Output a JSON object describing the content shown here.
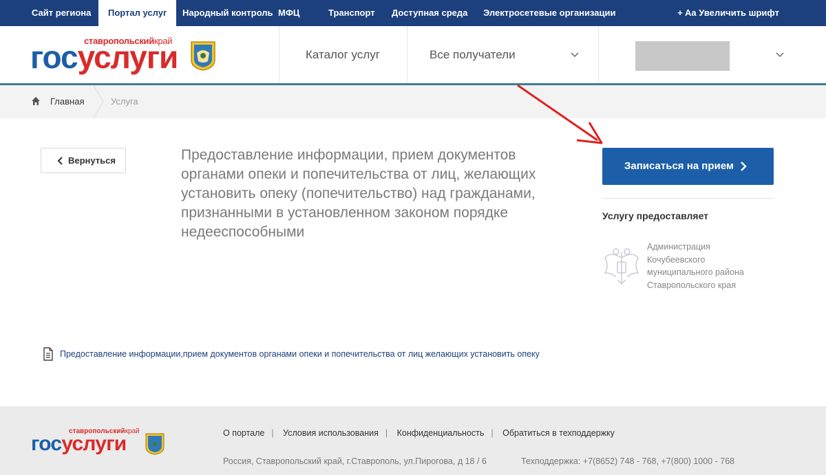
{
  "topnav": {
    "items": [
      "Сайт региона",
      "Портал услуг",
      "Народный контроль",
      "МФЦ",
      "Транспорт",
      "Доступная среда",
      "Электросетевые организации"
    ],
    "active": "Портал услуг",
    "font_toggle": "+ Aa Увеличить шрифт"
  },
  "header": {
    "logo_region": "ставропольский",
    "logo_region_suffix": "край",
    "logo_word_a": "гос",
    "logo_word_b": "услуги",
    "catalog": "Каталог услуг",
    "recipients": "Все получатели"
  },
  "breadcrumb": {
    "home": "Главная",
    "current": "Услуга"
  },
  "content": {
    "back": "Вернуться",
    "title": "Предоставление информации, прием документов органами опеки и попечительства от лиц, желающих установить опеку (попечительство) над гражданами, признанными в установленном законом порядке недееспособными",
    "appointment": "Записаться на прием",
    "provider_heading": "Услугу предоставляет",
    "provider_name": "Администрация Кочубеевского муниципального района Ставропольского края",
    "doc_link": "Предоставление информации,прием документов органами опеки и попечительства от лиц желающих установить опеку"
  },
  "footer": {
    "links": [
      "О портале",
      "Условия использования",
      "Конфиденциальность",
      "Обратиться в техподдержку"
    ],
    "address": "Россия, Ставропольский край, г.Ставрополь, ул.Пирогова, д 18 / 6",
    "phone": "Техподдержка: +7(8652) 748 - 768, +7(800) 1000 - 768"
  },
  "colors": {
    "nav_bg": "#1c3f7d",
    "button_blue": "#1c5fa8",
    "logo_red": "#d92b2b",
    "accent_teal": "#3a7d93",
    "annotation_red": "#e02020"
  },
  "icons": [
    "home-icon",
    "chevron-down-icon",
    "chevron-left-icon",
    "chevron-right-icon",
    "document-icon",
    "coat-of-arms-icon",
    "emblem-icon"
  ]
}
